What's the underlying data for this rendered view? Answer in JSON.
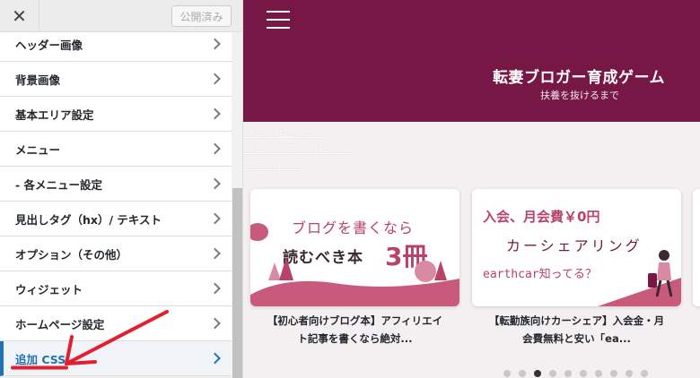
{
  "customizer": {
    "close_label": "✕",
    "publish_label": "公開済み",
    "menu_items": [
      "ヘッダー画像",
      "背景画像",
      "基本エリア設定",
      "メニュー",
      "- 各メニュー設定",
      "見出しタグ（hx）/ テキスト",
      "オプション（その他）",
      "ウィジェット",
      "ホームページ設定",
      "追加 CSS"
    ],
    "active_item": "追加 CSS"
  },
  "preview": {
    "site_title": "転妻ブロガー育成ゲーム",
    "site_tagline": "扶養を抜けるまで",
    "ghost_links": [
      "ブログ運営のコツ",
      "ブログとアフィリエイト",
      "プロフィール"
    ],
    "cards": [
      {
        "image_text": {
          "line1": "ブログを書くなら",
          "line2": "読むべき本",
          "num": "3冊"
        },
        "title_line1": "【初心者向けブログ本】アフィリエイ",
        "title_line2": "ト記事を書くなら絶対..."
      },
      {
        "image_text": {
          "line1": "入会、月会費￥0円",
          "line2": "カーシェアリング",
          "line3": "earthcar知ってる？"
        },
        "title_line1": "【転勤族向けカーシェア】入会金・月",
        "title_line2": "会費無料と安い「ea..."
      }
    ],
    "carousel": {
      "total": 10,
      "active_index": 2
    }
  },
  "colors": {
    "header_bg": "#761745",
    "accent_blue": "#2271b1",
    "annotation_red": "#e0202e"
  }
}
